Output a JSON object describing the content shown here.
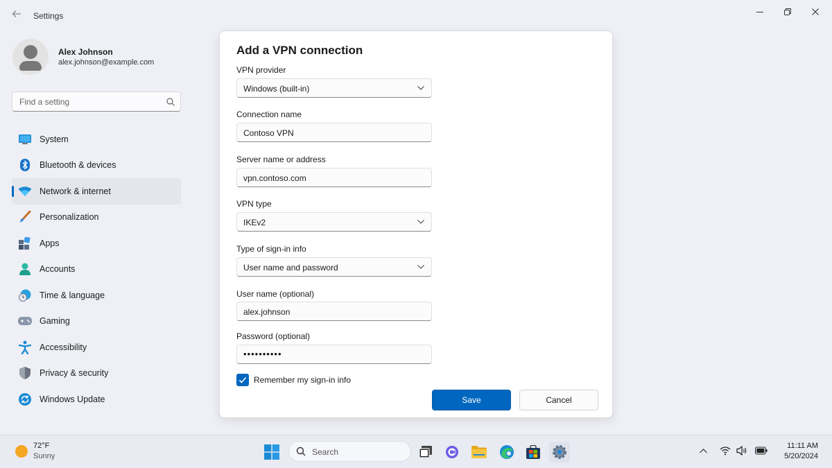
{
  "window": {
    "title": "Settings",
    "back_icon": "back-arrow-icon",
    "controls": [
      "minimize-icon",
      "restore-icon",
      "close-icon"
    ]
  },
  "profile": {
    "name": "Alex Johnson",
    "email": "alex.johnson@example.com"
  },
  "search": {
    "placeholder": "Find a setting"
  },
  "sidebar": {
    "items": [
      {
        "label": "System",
        "icon": "monitor-icon"
      },
      {
        "label": "Bluetooth & devices",
        "icon": "bluetooth-icon"
      },
      {
        "label": "Network & internet",
        "icon": "wifi-icon",
        "active": true
      },
      {
        "label": "Personalization",
        "icon": "brush-icon"
      },
      {
        "label": "Apps",
        "icon": "apps-icon"
      },
      {
        "label": "Accounts",
        "icon": "person-icon"
      },
      {
        "label": "Time & language",
        "icon": "globe-clock-icon"
      },
      {
        "label": "Gaming",
        "icon": "gamepad-icon"
      },
      {
        "label": "Accessibility",
        "icon": "accessibility-icon"
      },
      {
        "label": "Privacy & security",
        "icon": "shield-icon"
      },
      {
        "label": "Windows Update",
        "icon": "update-icon"
      }
    ]
  },
  "dialog": {
    "title": "Add a VPN connection",
    "vpn_provider": {
      "label": "VPN provider",
      "value": "Windows (built-in)"
    },
    "connection_name": {
      "label": "Connection name",
      "value": "Contoso VPN"
    },
    "server": {
      "label": "Server name or address",
      "value": "vpn.contoso.com"
    },
    "vpn_type": {
      "label": "VPN type",
      "value": "IKEv2"
    },
    "signin_type": {
      "label": "Type of sign-in info",
      "value": "User name and password"
    },
    "username": {
      "label": "User name (optional)",
      "value": "alex.johnson"
    },
    "password": {
      "label": "Password (optional)",
      "value": "••••••••••"
    },
    "remember": {
      "label": "Remember my sign-in info",
      "checked": true
    },
    "save_label": "Save",
    "cancel_label": "Cancel"
  },
  "taskbar": {
    "weather_temp": "72°F",
    "weather_condition": "Sunny",
    "search_label": "Search",
    "time": "11:11 AM",
    "date": "5/20/2024"
  },
  "colors": {
    "accent": "#0067c0",
    "background": "#eef0f6",
    "dialog": "#ffffff"
  }
}
